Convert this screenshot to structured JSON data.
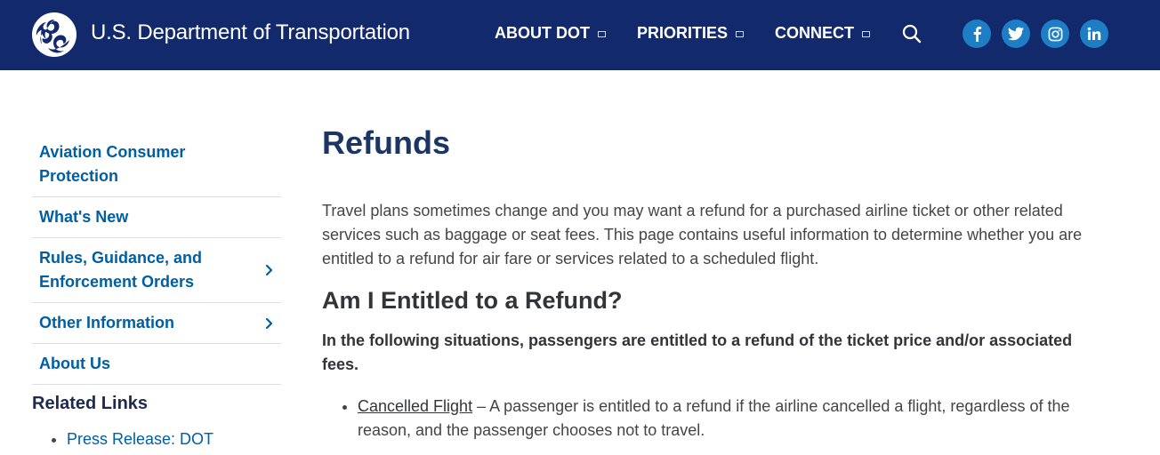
{
  "header": {
    "site_title": "U.S. Department of Transportation",
    "logo_icon": "dot-triskelion-logo",
    "nav": [
      {
        "label": "ABOUT DOT",
        "icon": "caret-box-icon"
      },
      {
        "label": "PRIORITIES",
        "icon": "caret-box-icon"
      },
      {
        "label": "CONNECT",
        "icon": "caret-box-icon"
      }
    ],
    "search_icon": "search-icon",
    "social": [
      "facebook-icon",
      "twitter-icon",
      "instagram-icon",
      "linkedin-icon"
    ],
    "colors": {
      "header_bg": "#12296b",
      "social_bg": "#1d7ec6"
    }
  },
  "sidebar": {
    "items": [
      {
        "label": "Aviation Consumer Protection"
      },
      {
        "label": "What's New"
      },
      {
        "label": "Rules, Guidance, and Enforcement Orders",
        "icon": "chevron-right-icon"
      },
      {
        "label": "Other Information",
        "icon": "chevron-right-icon"
      },
      {
        "label": "About Us"
      }
    ],
    "related_title": "Related Links",
    "related_links": [
      "Press Release: DOT"
    ]
  },
  "main": {
    "title": "Refunds",
    "intro": "Travel plans sometimes change and you may want a refund for a purchased airline ticket or other related services such as baggage or seat fees.  This page contains useful information to determine whether you are entitled to a refund for air fare or services related to a scheduled flight.",
    "section_heading": "Am I Entitled to a Refund?",
    "lead": "In the following situations, passengers are entitled to a refund of the ticket price and/or associated fees.",
    "bullets": [
      {
        "link": "Cancelled Flight",
        "text": " – A passenger is entitled to a refund if the airline cancelled a flight, regardless of the reason, and the passenger chooses not to travel."
      }
    ]
  }
}
